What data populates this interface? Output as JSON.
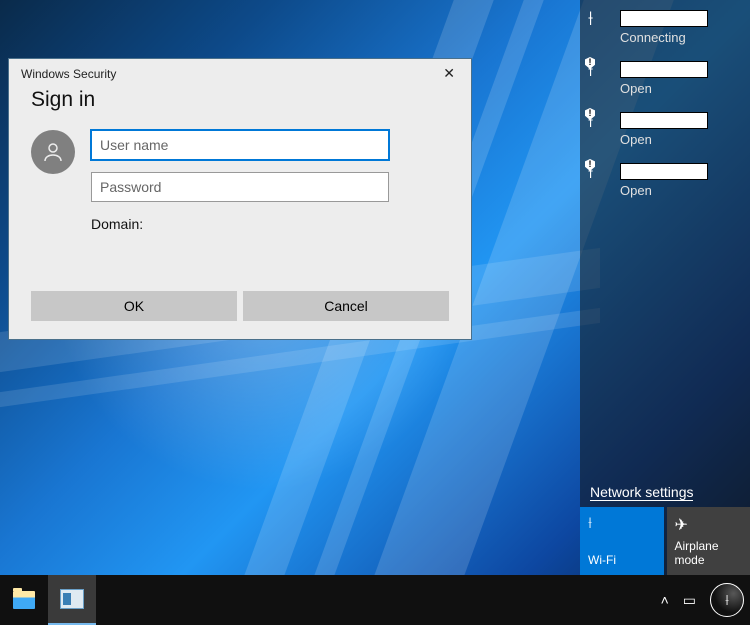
{
  "dialog": {
    "title": "Windows Security",
    "heading": "Sign in",
    "username_placeholder": "User name",
    "password_placeholder": "Password",
    "domain_label": "Domain:",
    "ok_label": "OK",
    "cancel_label": "Cancel"
  },
  "network_panel": {
    "items": [
      {
        "ssid": "",
        "status": "Connecting",
        "secured": false
      },
      {
        "ssid": "",
        "status": "Open",
        "secured": false
      },
      {
        "ssid": "",
        "status": "Open",
        "secured": false
      },
      {
        "ssid": "",
        "status": "Open",
        "secured": false
      }
    ],
    "settings_link": "Network settings",
    "tiles": {
      "wifi": "Wi-Fi",
      "airplane": "Airplane mode"
    }
  },
  "taskbar": {
    "tray": {
      "chevron": "˄",
      "battery": "▭"
    }
  }
}
